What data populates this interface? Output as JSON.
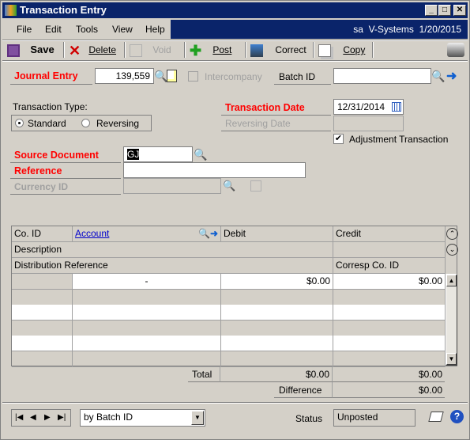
{
  "window": {
    "title": "Transaction Entry",
    "min": "_",
    "max": "□",
    "close": "✕"
  },
  "menu": {
    "items": [
      "File",
      "Edit",
      "Tools",
      "View",
      "Help"
    ],
    "user": "sa",
    "company": "V-Systems",
    "date": "1/20/2015"
  },
  "toolbar": {
    "save": "Save",
    "delete": "Delete",
    "void": "Void",
    "post": "Post",
    "correct": "Correct",
    "copy": "Copy"
  },
  "form": {
    "journal_entry_label": "Journal Entry",
    "journal_entry_value": "139,559",
    "intercompany_label": "Intercompany",
    "batch_id_label": "Batch ID",
    "batch_id_value": "",
    "transaction_type_label": "Transaction Type:",
    "type_standard": "Standard",
    "type_reversing": "Reversing",
    "selected_type": "Standard",
    "transaction_date_label": "Transaction Date",
    "transaction_date_value": "12/31/2014",
    "reversing_date_label": "Reversing Date",
    "adjustment_label": "Adjustment Transaction",
    "adjustment_checked": true,
    "source_document_label": "Source Document",
    "source_document_value": "GJ",
    "reference_label": "Reference",
    "reference_value": "",
    "currency_id_label": "Currency ID"
  },
  "grid": {
    "headers": {
      "co_id": "Co. ID",
      "account": "Account",
      "debit": "Debit",
      "credit": "Credit",
      "description": "Description",
      "distribution_reference": "Distribution Reference",
      "corresp_co_id": "Corresp Co. ID"
    },
    "rows": [
      {
        "co_id": "",
        "account": "-",
        "debit": "$0.00",
        "credit": "$0.00"
      },
      {},
      {},
      {},
      {},
      {}
    ],
    "total_label": "Total",
    "total_debit": "$0.00",
    "total_credit": "$0.00",
    "difference_label": "Difference",
    "difference_value": "$0.00"
  },
  "footer": {
    "sort_by": "by Batch ID",
    "status_label": "Status",
    "status_value": "Unposted"
  }
}
